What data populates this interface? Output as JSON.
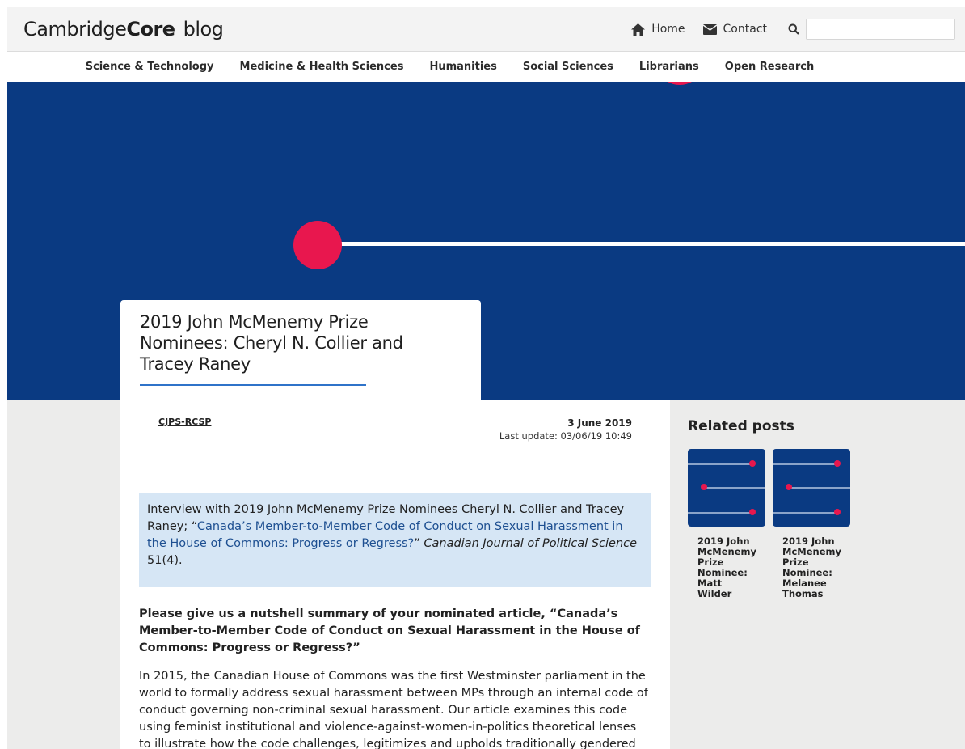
{
  "header": {
    "logo_part1": "Cambridge",
    "logo_part2": "Core",
    "logo_part3": "blog",
    "home_label": "Home",
    "contact_label": "Contact",
    "search_placeholder": ""
  },
  "category_nav": [
    "Science & Technology",
    "Medicine & Health Sciences",
    "Humanities",
    "Social Sciences",
    "Librarians",
    "Open Research"
  ],
  "colors": {
    "hero_blue": "#0a3a82",
    "accent_pink": "#e8174e",
    "callout_bg": "#d6e6f5",
    "underline_blue": "#2f73c9"
  },
  "article": {
    "title": "2019 John McMenemy Prize Nominees: Cheryl N. Collier and Tracey Raney",
    "author": "CJPS-RCSP",
    "date": "3 June 2019",
    "last_update": "Last update: 03/06/19 10:49",
    "callout_intro": "Interview with 2019 John McMenemy Prize Nominees Cheryl N. Collier and Tracey Raney; “",
    "callout_link": "Canada’s Member-to-Member Code of Conduct on Sexual Harassment in the House of Commons: Progress or Regress?",
    "callout_after_link": "” ",
    "callout_journal": "Canadian Journal of Political Science",
    "callout_volume": " 51(4).",
    "question": "Please give us a nutshell summary of your nominated article, “Canada’s Member-to-Member Code of Conduct on Sexual Harassment in the House of Commons: Progress or Regress?”",
    "paragraph": "In 2015, the Canadian House of Commons was the first Westminster parliament in the world to formally address sexual harassment between MPs through an internal code of conduct governing non-criminal sexual harassment.  Our article examines this code using feminist institutional and violence-against-women-in-politics theoretical lenses to illustrate how the code challenges, legitimizes and upholds traditionally gendered"
  },
  "related": {
    "heading": "Related posts",
    "posts": [
      {
        "title": "2019 John McMenemy Prize Nominee: Matt Wilder"
      },
      {
        "title": "2019 John McMenemy Prize Nominee: Melanee Thomas"
      }
    ]
  }
}
